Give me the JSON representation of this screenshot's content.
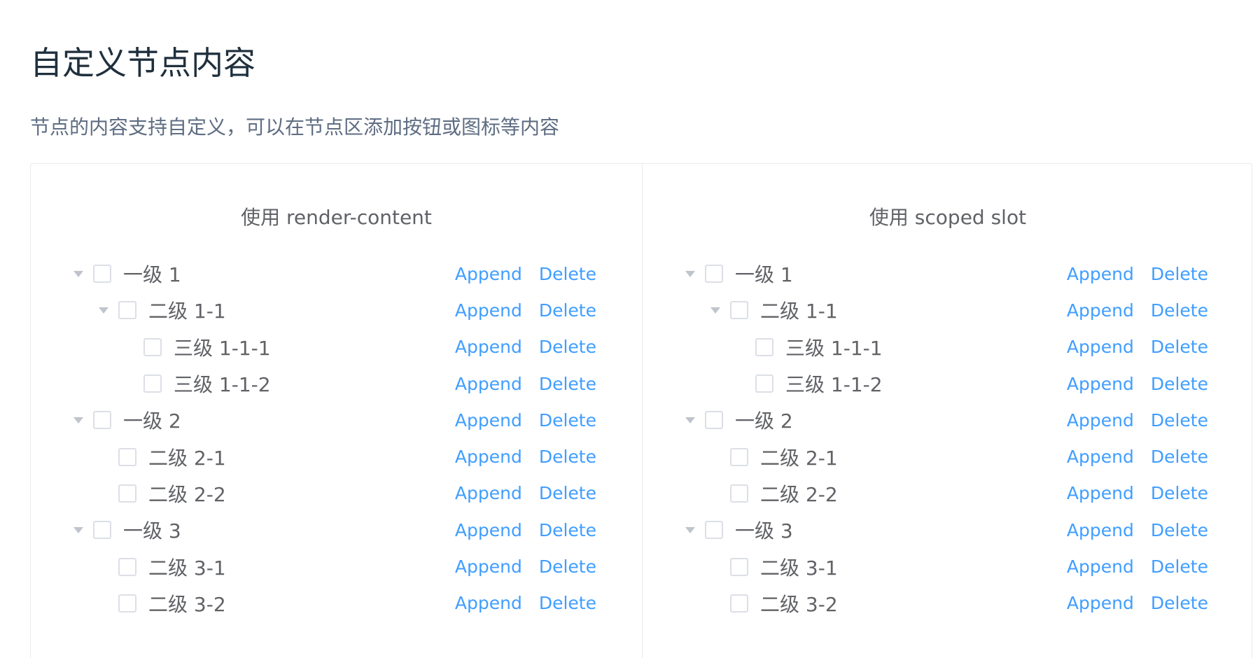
{
  "page": {
    "title": "自定义节点内容",
    "description": "节点的内容支持自定义，可以在节点区添加按钮或图标等内容"
  },
  "panels": [
    {
      "title": "使用 render-content",
      "nodes": [
        {
          "label": "一级 1",
          "level": 1,
          "expandable": true,
          "append": "Append",
          "delete": "Delete"
        },
        {
          "label": "二级 1-1",
          "level": 2,
          "expandable": true,
          "append": "Append",
          "delete": "Delete"
        },
        {
          "label": "三级 1-1-1",
          "level": 3,
          "expandable": false,
          "append": "Append",
          "delete": "Delete"
        },
        {
          "label": "三级 1-1-2",
          "level": 3,
          "expandable": false,
          "append": "Append",
          "delete": "Delete"
        },
        {
          "label": "一级 2",
          "level": 1,
          "expandable": true,
          "append": "Append",
          "delete": "Delete"
        },
        {
          "label": "二级 2-1",
          "level": 2,
          "expandable": false,
          "append": "Append",
          "delete": "Delete"
        },
        {
          "label": "二级 2-2",
          "level": 2,
          "expandable": false,
          "append": "Append",
          "delete": "Delete"
        },
        {
          "label": "一级 3",
          "level": 1,
          "expandable": true,
          "append": "Append",
          "delete": "Delete"
        },
        {
          "label": "二级 3-1",
          "level": 2,
          "expandable": false,
          "append": "Append",
          "delete": "Delete"
        },
        {
          "label": "二级 3-2",
          "level": 2,
          "expandable": false,
          "append": "Append",
          "delete": "Delete"
        }
      ]
    },
    {
      "title": "使用 scoped slot",
      "nodes": [
        {
          "label": "一级 1",
          "level": 1,
          "expandable": true,
          "append": "Append",
          "delete": "Delete"
        },
        {
          "label": "二级 1-1",
          "level": 2,
          "expandable": true,
          "append": "Append",
          "delete": "Delete"
        },
        {
          "label": "三级 1-1-1",
          "level": 3,
          "expandable": false,
          "append": "Append",
          "delete": "Delete"
        },
        {
          "label": "三级 1-1-2",
          "level": 3,
          "expandable": false,
          "append": "Append",
          "delete": "Delete"
        },
        {
          "label": "一级 2",
          "level": 1,
          "expandable": true,
          "append": "Append",
          "delete": "Delete"
        },
        {
          "label": "二级 2-1",
          "level": 2,
          "expandable": false,
          "append": "Append",
          "delete": "Delete"
        },
        {
          "label": "二级 2-2",
          "level": 2,
          "expandable": false,
          "append": "Append",
          "delete": "Delete"
        },
        {
          "label": "一级 3",
          "level": 1,
          "expandable": true,
          "append": "Append",
          "delete": "Delete"
        },
        {
          "label": "二级 3-1",
          "level": 2,
          "expandable": false,
          "append": "Append",
          "delete": "Delete"
        },
        {
          "label": "二级 3-2",
          "level": 2,
          "expandable": false,
          "append": "Append",
          "delete": "Delete"
        }
      ]
    }
  ],
  "colors": {
    "link": "#409eff",
    "text": "#606266",
    "title": "#1f2f3d",
    "description": "#5e6d82",
    "border": "#ebebeb",
    "checkbox_border": "#dcdfe6",
    "expand_icon": "#c0c4cc"
  },
  "icons": {
    "expand": "caret-down-icon"
  }
}
